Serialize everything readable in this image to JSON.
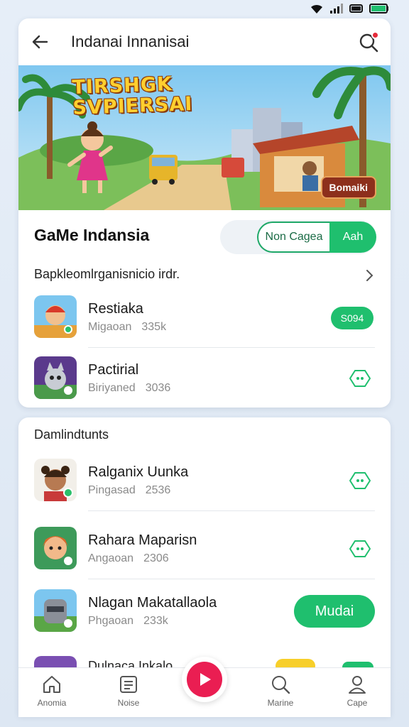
{
  "app": {
    "title": "Indanai Innanisai"
  },
  "banner": {
    "title_line1": "TIRSHGK",
    "title_line2": "SVPIERSAI",
    "badge": "Bomaiki"
  },
  "section": {
    "title": "GaMe Indansia",
    "toggle_left": "Non Cagea",
    "toggle_right": "Aah",
    "subtitle": "Bapkleomlrganisnicio irdr."
  },
  "top_list": [
    {
      "name": "Restiaka",
      "meta1": "Migaoan",
      "meta2": "335k",
      "action": "S094",
      "action_type": "pill"
    },
    {
      "name": "Pactirial",
      "meta1": "Biriyaned",
      "meta2": "3036",
      "action": "",
      "action_type": "hex"
    }
  ],
  "bottom_section": {
    "title": "Damlindtunts"
  },
  "bottom_list": [
    {
      "name": "Ralganix Uunka",
      "meta1": "Pingasad",
      "meta2": "2536",
      "action": "",
      "action_type": "hex"
    },
    {
      "name": "Rahara Maparisn",
      "meta1": "Angaoan",
      "meta2": "2306",
      "action": "",
      "action_type": "hex"
    },
    {
      "name": "Nlagan Makatallaola",
      "meta1": "Phgaoan",
      "meta2": "233k",
      "action": "Mudai",
      "action_type": "big"
    },
    {
      "name": "Dulnaca Inkalo",
      "meta1": "",
      "meta2": "",
      "action": "",
      "action_type": "peek"
    }
  ],
  "tabs": [
    {
      "label": "Anomia",
      "icon": "home-icon"
    },
    {
      "label": "Noise",
      "icon": "list-icon"
    },
    {
      "label": "",
      "icon": "play-icon"
    },
    {
      "label": "Marine",
      "icon": "search-icon"
    },
    {
      "label": "Cape",
      "icon": "profile-icon"
    }
  ],
  "colors": {
    "accent_green": "#1fbf6e",
    "accent_red": "#ea1e52",
    "background": "#e6eef8"
  }
}
